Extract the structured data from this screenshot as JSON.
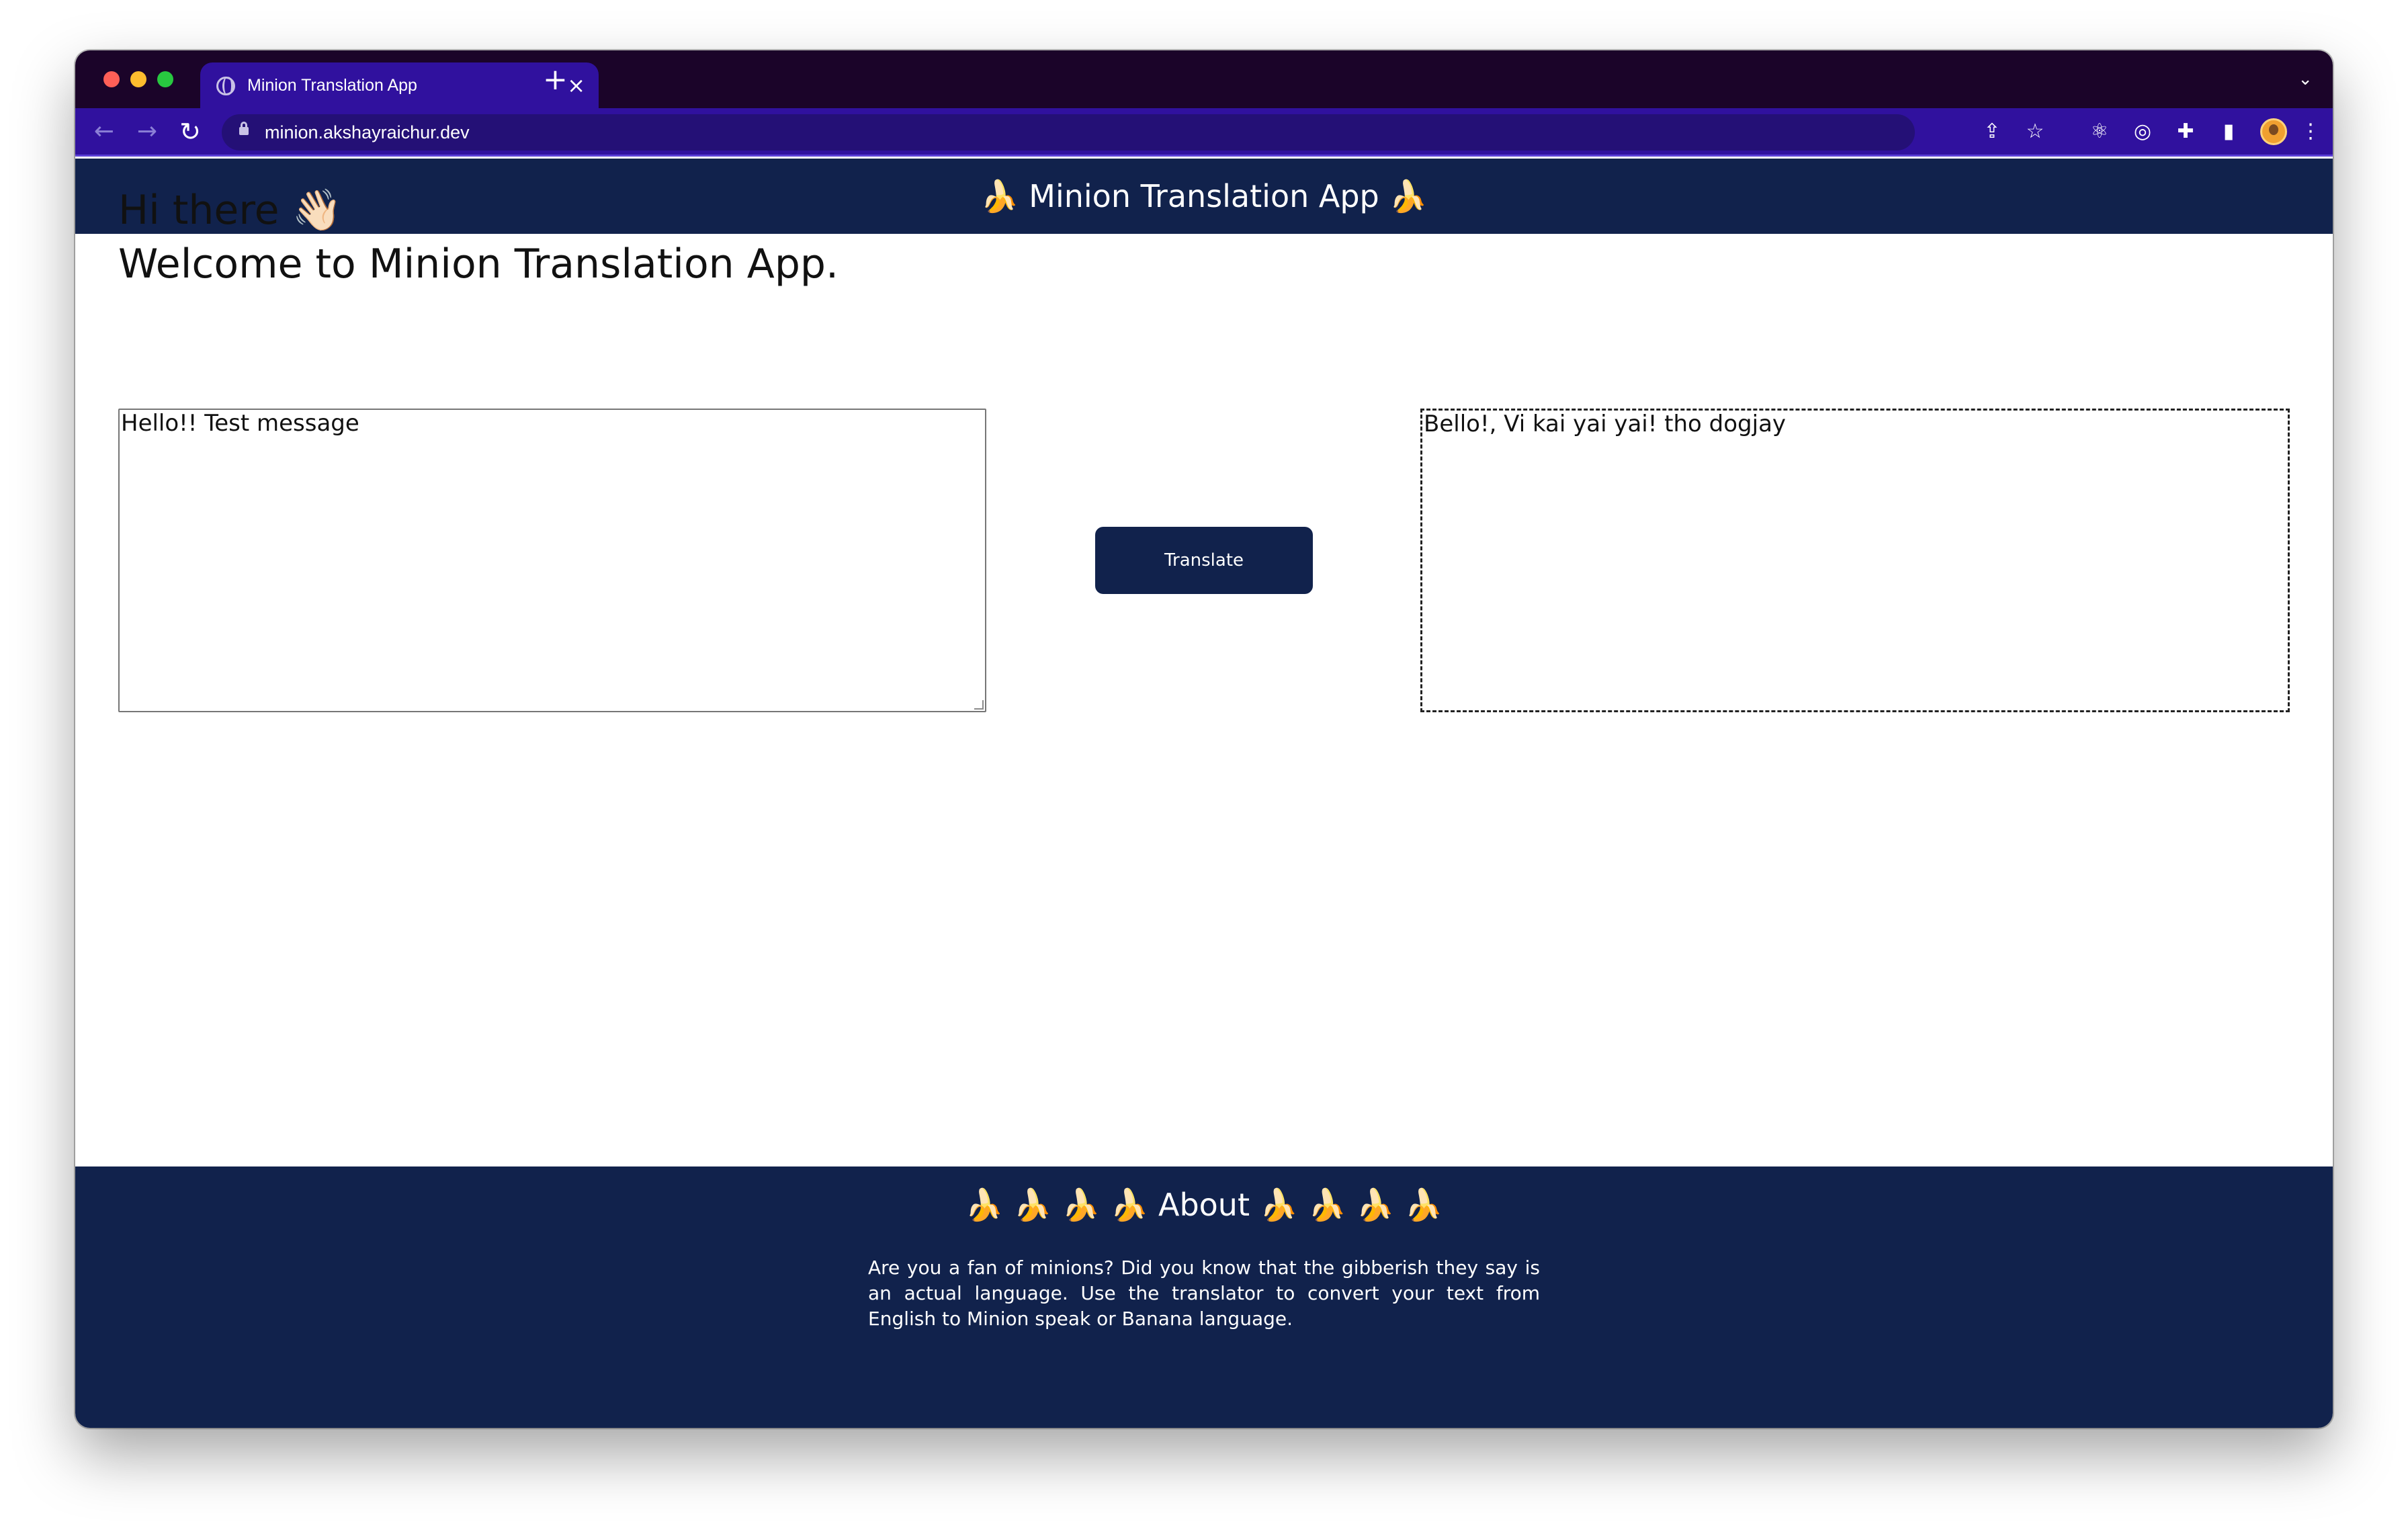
{
  "browser": {
    "tab_title": "Minion Translation App",
    "tab_close": "×",
    "new_tab": "+",
    "tab_menu": "⌄",
    "url": "minion.akshayraichur.dev",
    "icons": {
      "back": "←",
      "forward": "→",
      "reload": "↻",
      "share": "⇪",
      "star": "☆",
      "react": "⚛",
      "record": "◎",
      "puzzle": "✚",
      "sidepanel": "▮",
      "more": "⋮"
    }
  },
  "app": {
    "header_title": "🍌 Minion Translation App 🍌",
    "greeting": "Hi there 👋🏻",
    "welcome": "Welcome to Minion Translation App.",
    "input_value": "Hello!! Test message",
    "translate_label": "Translate",
    "output_value": "Bello!, Vi kai yai yai! tho dogjay"
  },
  "footer": {
    "about_title": "🍌 🍌 🍌 🍌 About 🍌 🍌 🍌 🍌",
    "about_text": "Are you a fan of minions? Did you know that the gibberish they say is an actual language. Use the translator to convert your text from English to Minion speak or Banana language."
  },
  "colors": {
    "header_bg": "#11224c",
    "tabbar_bg": "#1b0429",
    "toolbar_bg": "#30119e",
    "button_bg": "#11224c"
  }
}
